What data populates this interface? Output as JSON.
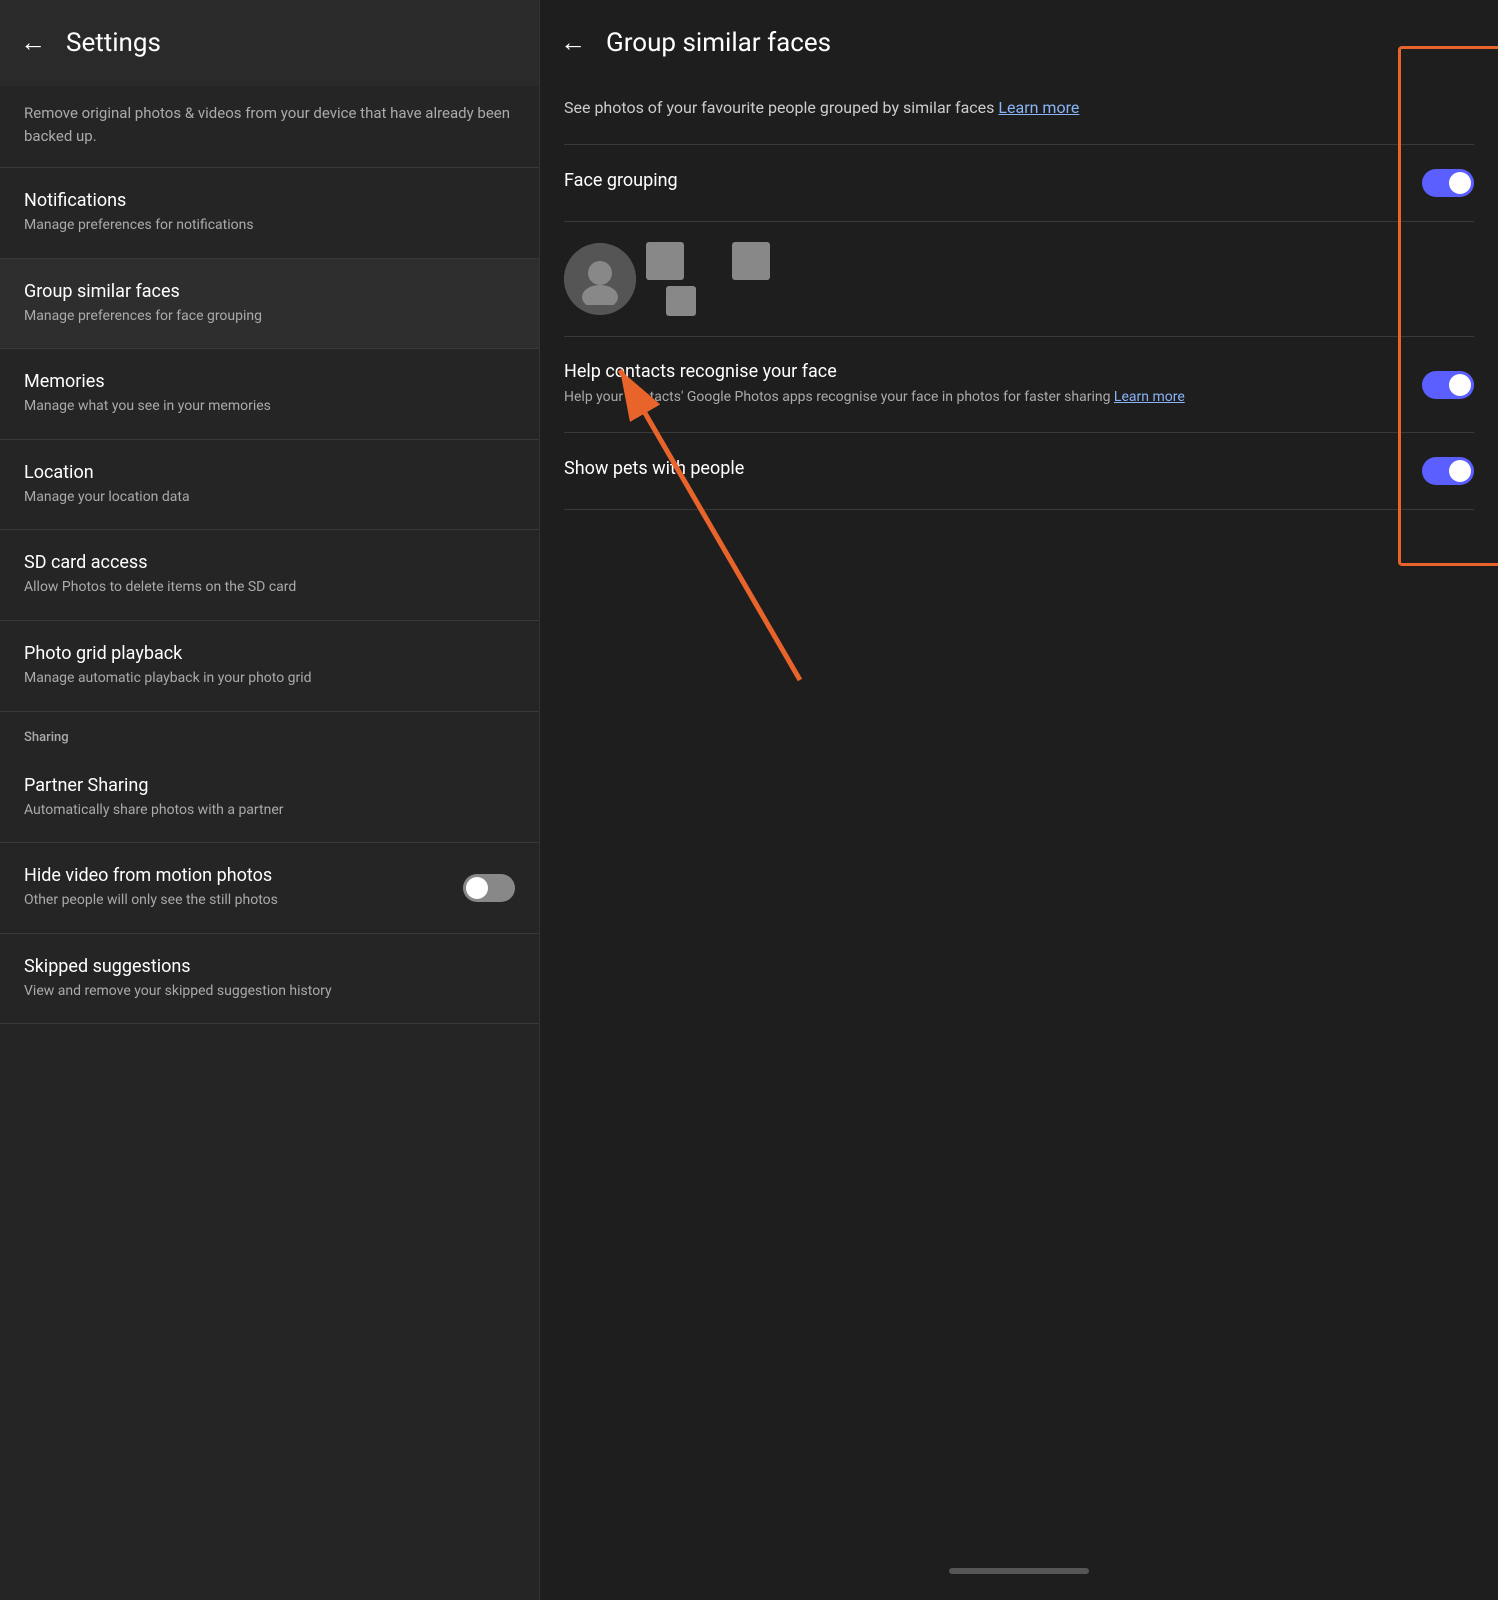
{
  "leftPanel": {
    "header": {
      "backIcon": "←",
      "title": "Settings"
    },
    "topDescription": "Remove original photos & videos from your device that have already been backed up.",
    "items": [
      {
        "id": "notifications",
        "title": "Notifications",
        "subtitle": "Manage preferences for notifications"
      },
      {
        "id": "group-similar-faces",
        "title": "Group similar faces",
        "subtitle": "Manage preferences for face grouping"
      },
      {
        "id": "memories",
        "title": "Memories",
        "subtitle": "Manage what you see in your memories"
      },
      {
        "id": "location",
        "title": "Location",
        "subtitle": "Manage your location data"
      },
      {
        "id": "sd-card-access",
        "title": "SD card access",
        "subtitle": "Allow Photos to delete items on the SD card"
      },
      {
        "id": "photo-grid-playback",
        "title": "Photo grid playback",
        "subtitle": "Manage automatic playback in your photo grid"
      }
    ],
    "sharingSection": {
      "header": "Sharing",
      "items": [
        {
          "id": "partner-sharing",
          "title": "Partner Sharing",
          "subtitle": "Automatically share photos with a partner"
        }
      ]
    },
    "toggleItems": [
      {
        "id": "hide-video",
        "title": "Hide video from motion photos",
        "subtitle": "Other people will only see the still photos",
        "toggleState": "off"
      }
    ],
    "bottomItems": [
      {
        "id": "skipped-suggestions",
        "title": "Skipped suggestions",
        "subtitle": "View and remove your skipped suggestion history"
      }
    ]
  },
  "rightPanel": {
    "header": {
      "backIcon": "←",
      "title": "Group similar faces"
    },
    "description": "See photos of your favourite people grouped by similar faces",
    "descriptionLink": "Learn more",
    "settings": [
      {
        "id": "face-grouping",
        "title": "Face grouping",
        "subtitle": "",
        "toggleState": "on"
      },
      {
        "id": "help-contacts",
        "title": "Help contacts recognise your face",
        "subtitle": "Help your contacts' Google Photos apps recognise your face in photos for faster sharing",
        "subtitleLink": "Learn more",
        "toggleState": "on"
      },
      {
        "id": "show-pets",
        "title": "Show pets with people",
        "subtitle": "",
        "toggleState": "on"
      }
    ]
  },
  "arrow": {
    "color": "#e8642a"
  }
}
